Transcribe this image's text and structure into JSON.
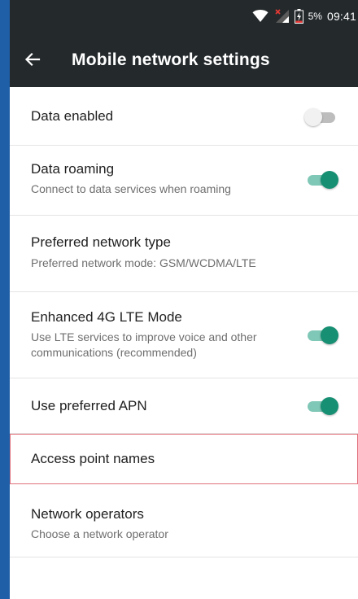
{
  "status_bar": {
    "battery_percent": "5%",
    "time": "09:41",
    "icons": [
      "wifi-icon",
      "signal-icon",
      "battery-icon"
    ]
  },
  "toolbar": {
    "back_icon": "arrow-left-icon",
    "title": "Mobile network settings"
  },
  "settings": [
    {
      "id": "data-enabled",
      "title": "Data enabled",
      "summary": "",
      "toggle": "off"
    },
    {
      "id": "data-roaming",
      "title": "Data roaming",
      "summary": "Connect to data services when roaming",
      "toggle": "on"
    },
    {
      "id": "preferred-network-type",
      "title": "Preferred network type",
      "summary": "Preferred network mode: GSM/WCDMA/LTE"
    },
    {
      "id": "enhanced-4g-lte",
      "title": "Enhanced 4G LTE Mode",
      "summary": "Use LTE services to improve voice and other communications (recommended)",
      "toggle": "on"
    },
    {
      "id": "use-preferred-apn",
      "title": "Use preferred APN",
      "summary": "",
      "toggle": "on"
    },
    {
      "id": "access-point-names",
      "title": "Access point names",
      "summary": "",
      "highlighted": true
    },
    {
      "id": "network-operators",
      "title": "Network operators",
      "summary": "Choose a network operator"
    }
  ],
  "colors": {
    "toolbar": "#24292c",
    "accent": "#168f73",
    "accent_track": "#7fc7b6",
    "highlight_border": "#e0707a",
    "outer_border": "#1f5fa8"
  }
}
